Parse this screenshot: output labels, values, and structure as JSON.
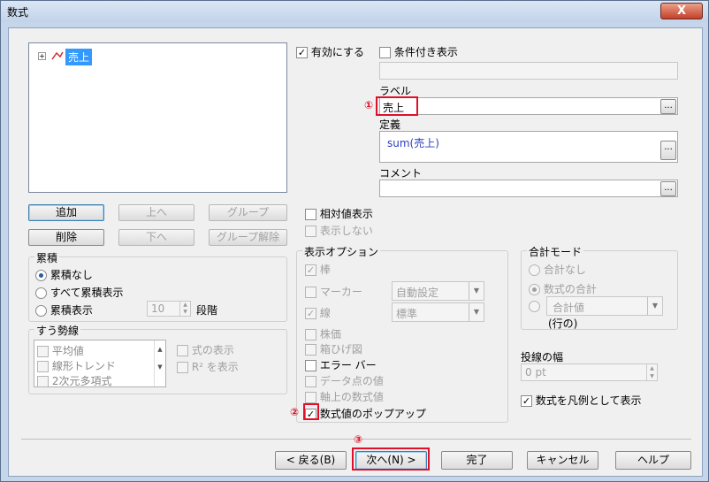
{
  "window": {
    "title": "数式",
    "close_glyph": "X"
  },
  "tree": {
    "expand_glyph": "+",
    "item_label": "売上"
  },
  "left_buttons": {
    "add": "追加",
    "up": "上へ",
    "group": "グループ",
    "delete": "削除",
    "down": "下へ",
    "ungroup": "グループ解除"
  },
  "accumulation": {
    "title": "累積",
    "none": "累積なし",
    "all": "すべて累積表示",
    "accum": "累積表示",
    "steps_value": "10",
    "steps_label": "段階"
  },
  "trend": {
    "title": "すう勢線",
    "items": [
      "平均値",
      "線形トレンド",
      "2次元多項式"
    ],
    "show_formula": "式の表示",
    "show_r2": "R² を表示"
  },
  "enable": {
    "label": "有効にする",
    "check": "✓"
  },
  "conditional": {
    "label": "条件付き表示"
  },
  "label_field": {
    "caption": "ラベル",
    "value": "売上",
    "ellipsis": "..."
  },
  "definition": {
    "caption": "定義",
    "value": "sum(売上)",
    "ellipsis": "..."
  },
  "comment": {
    "caption": "コメント",
    "value": "",
    "ellipsis": "..."
  },
  "relative": {
    "label": "相対値表示",
    "hide": "表示しない"
  },
  "display_options": {
    "title": "表示オプション",
    "bar": "棒",
    "marker": "マーカー",
    "marker_select": "自動設定",
    "line": "線",
    "line_select": "標準",
    "stock": "株価",
    "boxplot": "箱ひげ図",
    "errorbar": "エラー バー",
    "datavalues": "データ点の値",
    "axis_values": "軸上の数式値",
    "popup": "数式値のポップアップ",
    "check": "✓"
  },
  "total_mode": {
    "title": "合計モード",
    "none": "合計なし",
    "sum": "数式の合計",
    "value": "合計値",
    "row": "(行の)"
  },
  "line_width": {
    "title": "投線の幅",
    "value": "0 pt"
  },
  "legend": {
    "label": "数式を凡例として表示",
    "check": "✓"
  },
  "annotations": {
    "one": "①",
    "two": "②",
    "three": "③"
  },
  "footer": {
    "back": "< 戻る(B)",
    "next": "次へ(N) >",
    "finish": "完了",
    "cancel": "キャンセル",
    "help": "ヘルプ"
  },
  "colors": {
    "highlight": "#e0102a",
    "selection": "#3399ff"
  }
}
